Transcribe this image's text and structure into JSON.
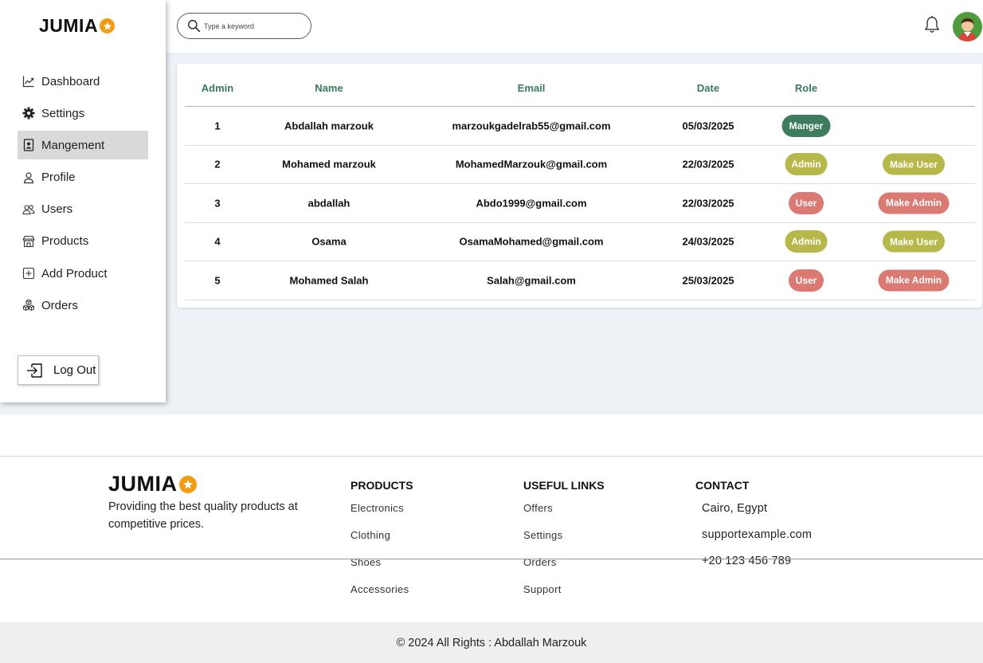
{
  "brand": {
    "name": "JUMIA"
  },
  "search": {
    "placeholder": "Type a keyword"
  },
  "sidebar": {
    "items": [
      {
        "label": "Dashboard",
        "icon": "chart-line-icon"
      },
      {
        "label": "Settings",
        "icon": "gear-icon"
      },
      {
        "label": "Mangement",
        "icon": "id-card-icon",
        "active": true
      },
      {
        "label": "Profile",
        "icon": "person-icon"
      },
      {
        "label": "Users",
        "icon": "users-icon"
      },
      {
        "label": "Products",
        "icon": "store-icon"
      },
      {
        "label": "Add Product",
        "icon": "plus-square-icon"
      },
      {
        "label": "Orders",
        "icon": "boxes-icon"
      }
    ],
    "logout": "Log Out"
  },
  "table": {
    "headers": {
      "admin": "Admin",
      "name": "Name",
      "email": "Email",
      "date": "Date",
      "role": "Role"
    },
    "rows": [
      {
        "id": "1",
        "name": "Abdallah marzouk",
        "email": "marzoukgadelrab55@gmail.com",
        "date": "05/03/2025",
        "role": "Manger",
        "action": ""
      },
      {
        "id": "2",
        "name": "Mohamed marzouk",
        "email": "MohamedMarzouk@gmail.com",
        "date": "22/03/2025",
        "role": "Admin",
        "action": "Make User"
      },
      {
        "id": "3",
        "name": "abdallah",
        "email": "Abdo1999@gmail.com",
        "date": "22/03/2025",
        "role": "User",
        "action": "Make Admin"
      },
      {
        "id": "4",
        "name": "Osama",
        "email": "OsamaMohamed@gmail.com",
        "date": "24/03/2025",
        "role": "Admin",
        "action": "Make User"
      },
      {
        "id": "5",
        "name": "Mohamed Salah",
        "email": "Salah@gmail.com",
        "date": "25/03/2025",
        "role": "User",
        "action": "Make Admin"
      }
    ]
  },
  "colors": {
    "manager": "#3f7c5e",
    "admin": "#b7b84a",
    "user": "#db7a72",
    "header_text": "#3a7a5c",
    "brand_star": "#f39c12"
  },
  "footer": {
    "tagline": "Providing the best quality products at competitive prices.",
    "products": {
      "title": "PRODUCTS",
      "links": [
        "Electronics",
        "Clothing",
        "Shoes",
        "Accessories"
      ]
    },
    "useful": {
      "title": "USEFUL LINKS",
      "links": [
        "Offers",
        "Settings",
        "Orders",
        "Support"
      ]
    },
    "contact": {
      "title": "CONTACT",
      "lines": [
        "Cairo, Egypt",
        "supportexample.com",
        "+20 123 456 789"
      ]
    },
    "copyright": "© 2024 All Rights : Abdallah Marzouk"
  }
}
